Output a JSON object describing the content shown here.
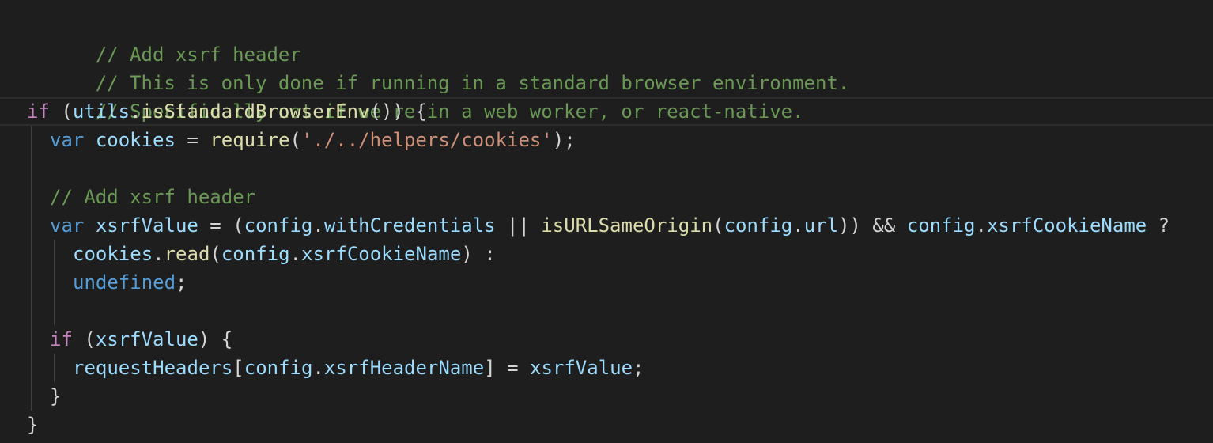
{
  "colors": {
    "background": "#1e1e1e",
    "comment": "#6a9955",
    "keyword": "#c586c0",
    "storage": "#569cd6",
    "variable": "#9cdcfe",
    "function": "#dcdcaa",
    "string": "#ce9178",
    "punctuation": "#d4d4d4"
  },
  "lines": {
    "l1": {
      "comment": "// Add xsrf header"
    },
    "l2": {
      "comment": "// This is only done if running in a standard browser environment."
    },
    "l3": {
      "comment": "// Specifically not if we're in a web worker, or react-native."
    },
    "l4": {
      "kw_if": "if",
      "p1": " (",
      "utils": "utils",
      "dot": ".",
      "fn": "isStandardBrowserEnv",
      "p2": "()) {"
    },
    "l5": {
      "kw_var": "var",
      "sp": " ",
      "name": "cookies",
      "eq": " = ",
      "fn": "require",
      "p1": "(",
      "str": "'./../helpers/cookies'",
      "p2": ");"
    },
    "l6": {
      "text": ""
    },
    "l7": {
      "comment": "// Add xsrf header"
    },
    "l8": {
      "kw_var": "var",
      "sp": " ",
      "name": "xsrfValue",
      "eq": " = (",
      "config1": "config",
      "dot1": ".",
      "prop1": "withCredentials",
      "or": " || ",
      "fn": "isURLSameOrigin",
      "p1": "(",
      "config2": "config",
      "dot2": ".",
      "prop2": "url",
      "p2": ")) && ",
      "config3": "config",
      "dot3": ".",
      "prop3": "xsrfCookieName",
      "q": " ?"
    },
    "l9": {
      "cookies": "cookies",
      "dot1": ".",
      "fn": "read",
      "p1": "(",
      "config": "config",
      "dot2": ".",
      "prop": "xsrfCookieName",
      "p2": ") :"
    },
    "l10": {
      "undef": "undefined",
      "semi": ";"
    },
    "l11": {
      "text": ""
    },
    "l12": {
      "kw_if": "if",
      "p1": " (",
      "name": "xsrfValue",
      "p2": ") {"
    },
    "l13": {
      "obj": "requestHeaders",
      "b1": "[",
      "config": "config",
      "dot": ".",
      "prop": "xsrfHeaderName",
      "b2": "] = ",
      "val": "xsrfValue",
      "semi": ";"
    },
    "l14": {
      "brace": "}"
    },
    "l15": {
      "brace": "}"
    }
  }
}
